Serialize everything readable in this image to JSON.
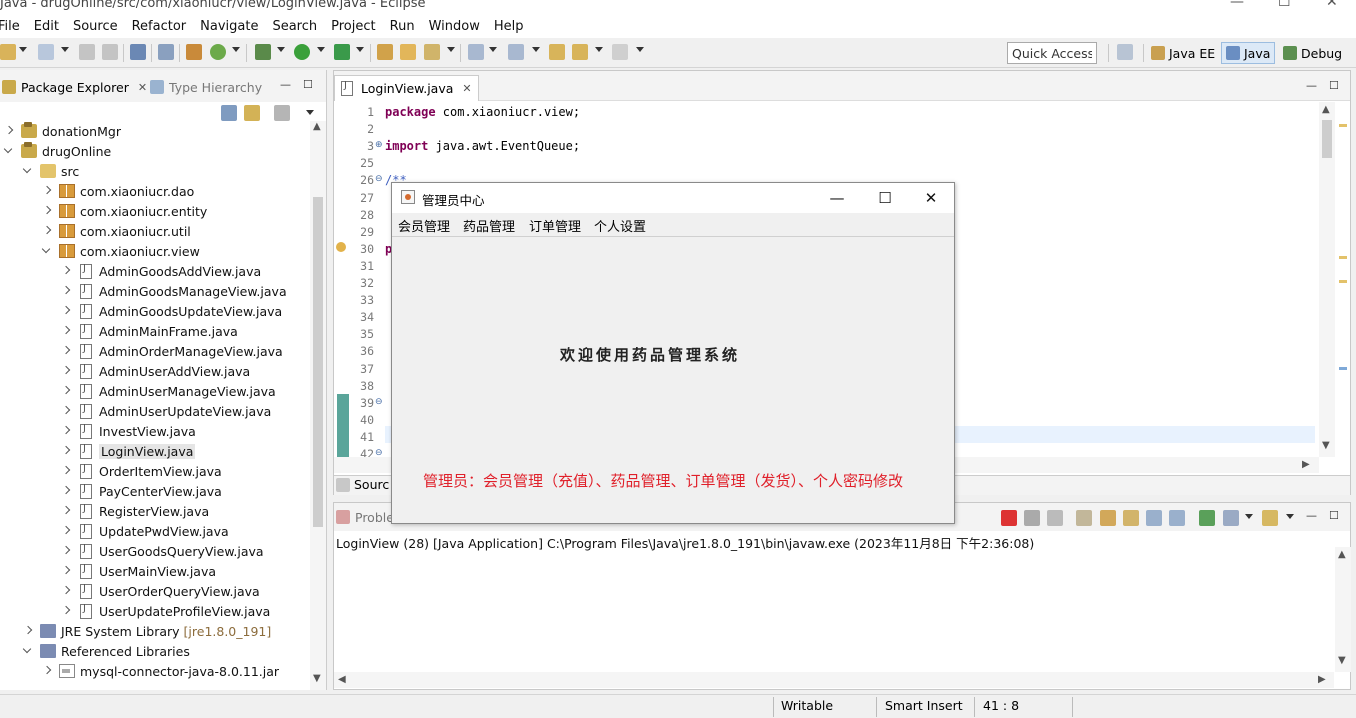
{
  "window": {
    "title": "Java - drugOnline/src/com/xiaoniucr/view/LoginView.java - Eclipse",
    "controls": [
      "—",
      "☐",
      "✕"
    ]
  },
  "menubar": [
    "File",
    "Edit",
    "Source",
    "Refactor",
    "Navigate",
    "Search",
    "Project",
    "Run",
    "Window",
    "Help"
  ],
  "toolbar": {
    "quick_access": "Quick Access",
    "perspectives": [
      {
        "label": "Java EE",
        "active": false
      },
      {
        "label": "Java",
        "active": true
      },
      {
        "label": "Debug",
        "active": false
      }
    ]
  },
  "package_explorer": {
    "tab_label": "Package Explorer",
    "inactive_tab_label": "Type Hierarchy",
    "tree": [
      {
        "label": "donationMgr",
        "icon": "project-icon",
        "toggle": "closed"
      },
      {
        "label": "drugOnline",
        "icon": "project-icon",
        "toggle": "open"
      },
      {
        "label": "src",
        "icon": "source-folder-icon",
        "toggle": "open"
      },
      {
        "label": "com.xiaoniucr.dao",
        "icon": "package-icon",
        "toggle": "closed"
      },
      {
        "label": "com.xiaoniucr.entity",
        "icon": "package-icon",
        "toggle": "closed"
      },
      {
        "label": "com.xiaoniucr.util",
        "icon": "package-icon",
        "toggle": "closed"
      },
      {
        "label": "com.xiaoniucr.view",
        "icon": "package-icon",
        "toggle": "open"
      },
      {
        "label": "AdminGoodsAddView.java",
        "icon": "java-file-icon",
        "toggle": "closed"
      },
      {
        "label": "AdminGoodsManageView.java",
        "icon": "java-file-icon",
        "toggle": "closed"
      },
      {
        "label": "AdminGoodsUpdateView.java",
        "icon": "java-file-icon",
        "toggle": "closed"
      },
      {
        "label": "AdminMainFrame.java",
        "icon": "java-file-icon",
        "toggle": "closed"
      },
      {
        "label": "AdminOrderManageView.java",
        "icon": "java-file-icon",
        "toggle": "closed"
      },
      {
        "label": "AdminUserAddView.java",
        "icon": "java-file-icon",
        "toggle": "closed"
      },
      {
        "label": "AdminUserManageView.java",
        "icon": "java-file-icon",
        "toggle": "closed"
      },
      {
        "label": "AdminUserUpdateView.java",
        "icon": "java-file-icon",
        "toggle": "closed"
      },
      {
        "label": "InvestView.java",
        "icon": "java-file-icon",
        "toggle": "closed"
      },
      {
        "label": "LoginView.java",
        "icon": "java-file-icon",
        "toggle": "closed",
        "selected": true
      },
      {
        "label": "OrderItemView.java",
        "icon": "java-file-icon",
        "toggle": "closed"
      },
      {
        "label": "PayCenterView.java",
        "icon": "java-file-icon",
        "toggle": "closed"
      },
      {
        "label": "RegisterView.java",
        "icon": "java-file-icon",
        "toggle": "closed"
      },
      {
        "label": "UpdatePwdView.java",
        "icon": "java-file-icon",
        "toggle": "closed"
      },
      {
        "label": "UserGoodsQueryView.java",
        "icon": "java-file-icon",
        "toggle": "closed"
      },
      {
        "label": "UserMainView.java",
        "icon": "java-file-icon",
        "toggle": "closed"
      },
      {
        "label": "UserOrderQueryView.java",
        "icon": "java-file-icon",
        "toggle": "closed"
      },
      {
        "label": "UserUpdateProfileView.java",
        "icon": "java-file-icon",
        "toggle": "closed"
      },
      {
        "label": "JRE System Library",
        "suffix": "[jre1.8.0_191]",
        "icon": "library-icon",
        "toggle": "closed"
      },
      {
        "label": "Referenced Libraries",
        "icon": "library-icon",
        "toggle": "open"
      },
      {
        "label": "mysql-connector-java-8.0.11.jar",
        "icon": "jar-icon",
        "toggle": "closed"
      }
    ]
  },
  "editor": {
    "tab_label": "LoginView.java",
    "bottom_tab": "Sourc",
    "line_numbers": [
      "1",
      "2",
      "3",
      "25",
      "26",
      "27",
      "28",
      "29",
      "30",
      "31",
      "32",
      "33",
      "34",
      "35",
      "36",
      "37",
      "38",
      "39",
      "40",
      "41",
      "42"
    ],
    "code_lines": [
      {
        "kw": "package",
        "rest": " com.xiaoniucr.view;"
      },
      {
        "kw": "",
        "rest": ""
      },
      {
        "kw": "import",
        "rest": " java.awt.EventQueue;"
      },
      {
        "kw": "",
        "rest": ""
      },
      {
        "comment": "/**"
      },
      {
        "kw": "",
        "rest": ""
      },
      {
        "kw": "",
        "rest": ""
      },
      {
        "kw": "",
        "rest": ""
      },
      {
        "kw": "p",
        "rest": ""
      }
    ]
  },
  "console": {
    "tab_label": "Proble",
    "path": "LoginView (28) [Java Application] C:\\Program Files\\Java\\jre1.8.0_191\\bin\\javaw.exe (2023年11月8日 下午2:36:08)"
  },
  "statusbar": {
    "writable": "Writable",
    "insert_mode": "Smart Insert",
    "position": "41 : 8"
  },
  "dialog": {
    "title": "管理员中心",
    "controls": [
      "—",
      "☐",
      "✕"
    ],
    "menus": [
      "会员管理",
      "药品管理",
      "订单管理",
      "个人设置"
    ],
    "welcome": "欢迎使用药品管理系统",
    "features": "管理员：会员管理（充值）、药品管理、订单管理（发货）、个人密码修改"
  },
  "colors": {
    "accent_red": "#e0202a",
    "keyword": "#7f0055",
    "comment": "#3f5fbf",
    "selection": "#dce9f7"
  }
}
